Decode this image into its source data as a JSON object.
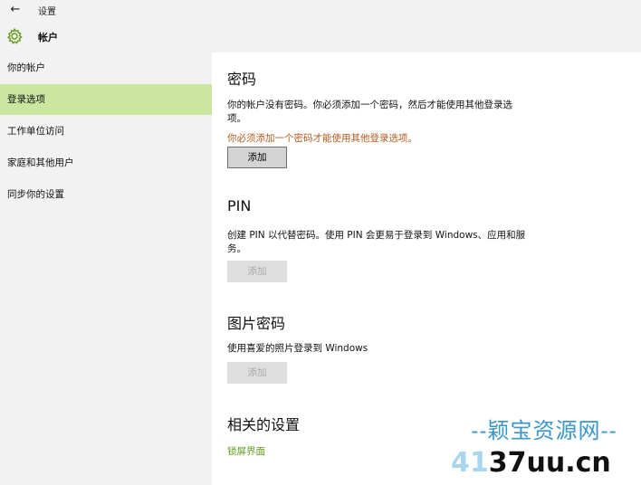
{
  "window": {
    "app_title": "设置",
    "back_icon": "back-arrow-icon"
  },
  "header": {
    "title": "帐户",
    "icon": "gear-icon",
    "accent_color": "#5f9c1a"
  },
  "sidebar": {
    "items": [
      {
        "label": "你的帐户"
      },
      {
        "label": "登录选项",
        "active": true
      },
      {
        "label": "工作单位访问"
      },
      {
        "label": "家庭和其他用户"
      },
      {
        "label": "同步你的设置"
      }
    ],
    "active_color": "#cbe6a0"
  },
  "password": {
    "title": "密码",
    "desc": "你的帐户没有密码。你必须添加一个密码，然后才能使用其他登录选项。",
    "warning": "你必须添加一个密码才能使用其他登录选项。",
    "add_label": "添加"
  },
  "pin": {
    "title": "PIN",
    "desc": "创建 PIN 以代替密码。使用 PIN 会更易于登录到 Windows、应用和服务。",
    "add_label": "添加"
  },
  "picture_password": {
    "title": "图片密码",
    "desc": "使用喜爱的照片登录到 Windows",
    "add_label": "添加"
  },
  "related": {
    "title": "相关的设置",
    "link": "锁屏界面"
  },
  "watermark": {
    "top_text": "--颖宝资源网--",
    "bottom_pale": "41",
    "bottom_dark": "37uu.cn"
  }
}
